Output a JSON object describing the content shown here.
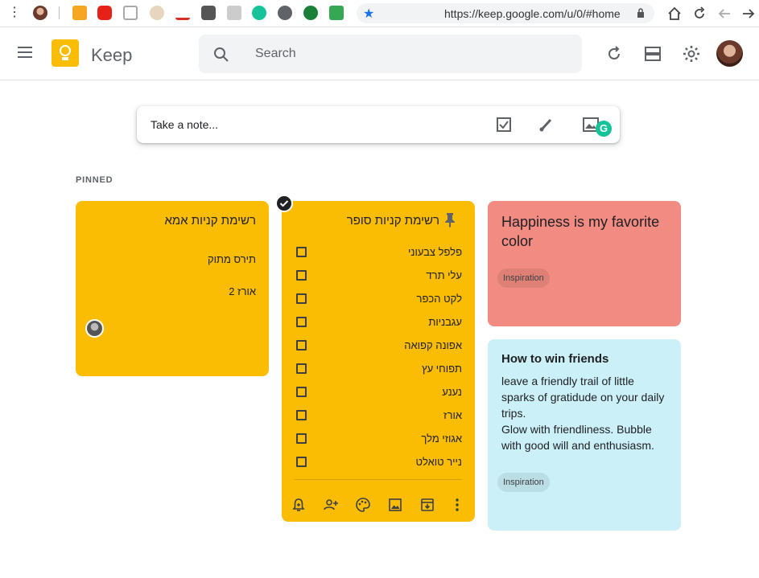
{
  "browser": {
    "url": "https://keep.google.com/u/0/#home",
    "menu_glyph": "⋮"
  },
  "header": {
    "app_name": "Keep",
    "search_placeholder": "Search"
  },
  "note_input": {
    "placeholder": "Take a note...",
    "grammarly_glyph": "G"
  },
  "section": {
    "pinned_label": "PINNED"
  },
  "notes": {
    "mom_list": {
      "title": "רשימת קניות אמא",
      "lines": [
        "תירס מתוק",
        "אורז 2"
      ]
    },
    "super_list": {
      "title": "רשימת קניות סופר",
      "items": [
        "פלפל צבעוני",
        "עלי תרד",
        "לקט הכפר",
        "עגבניות",
        "אפונה קפואה",
        "תפוחי עץ",
        "נענע",
        "אורז",
        "אגוזי מלך",
        "נייר טואלט"
      ]
    },
    "happiness": {
      "title": "Happiness is my favorite color",
      "label": "Inspiration"
    },
    "friends": {
      "title": "How to win friends",
      "body_1": "leave a friendly trail of little sparks of gratidude on your daily trips.",
      "body_2": "Glow with friendliness. Bubble with good will and enthusiasm.",
      "label": "Inspiration"
    }
  },
  "colors": {
    "yellow": "#fbbc04",
    "red": "#f28b82",
    "blue": "#cbf0f8",
    "accent": "#1a73e8"
  }
}
